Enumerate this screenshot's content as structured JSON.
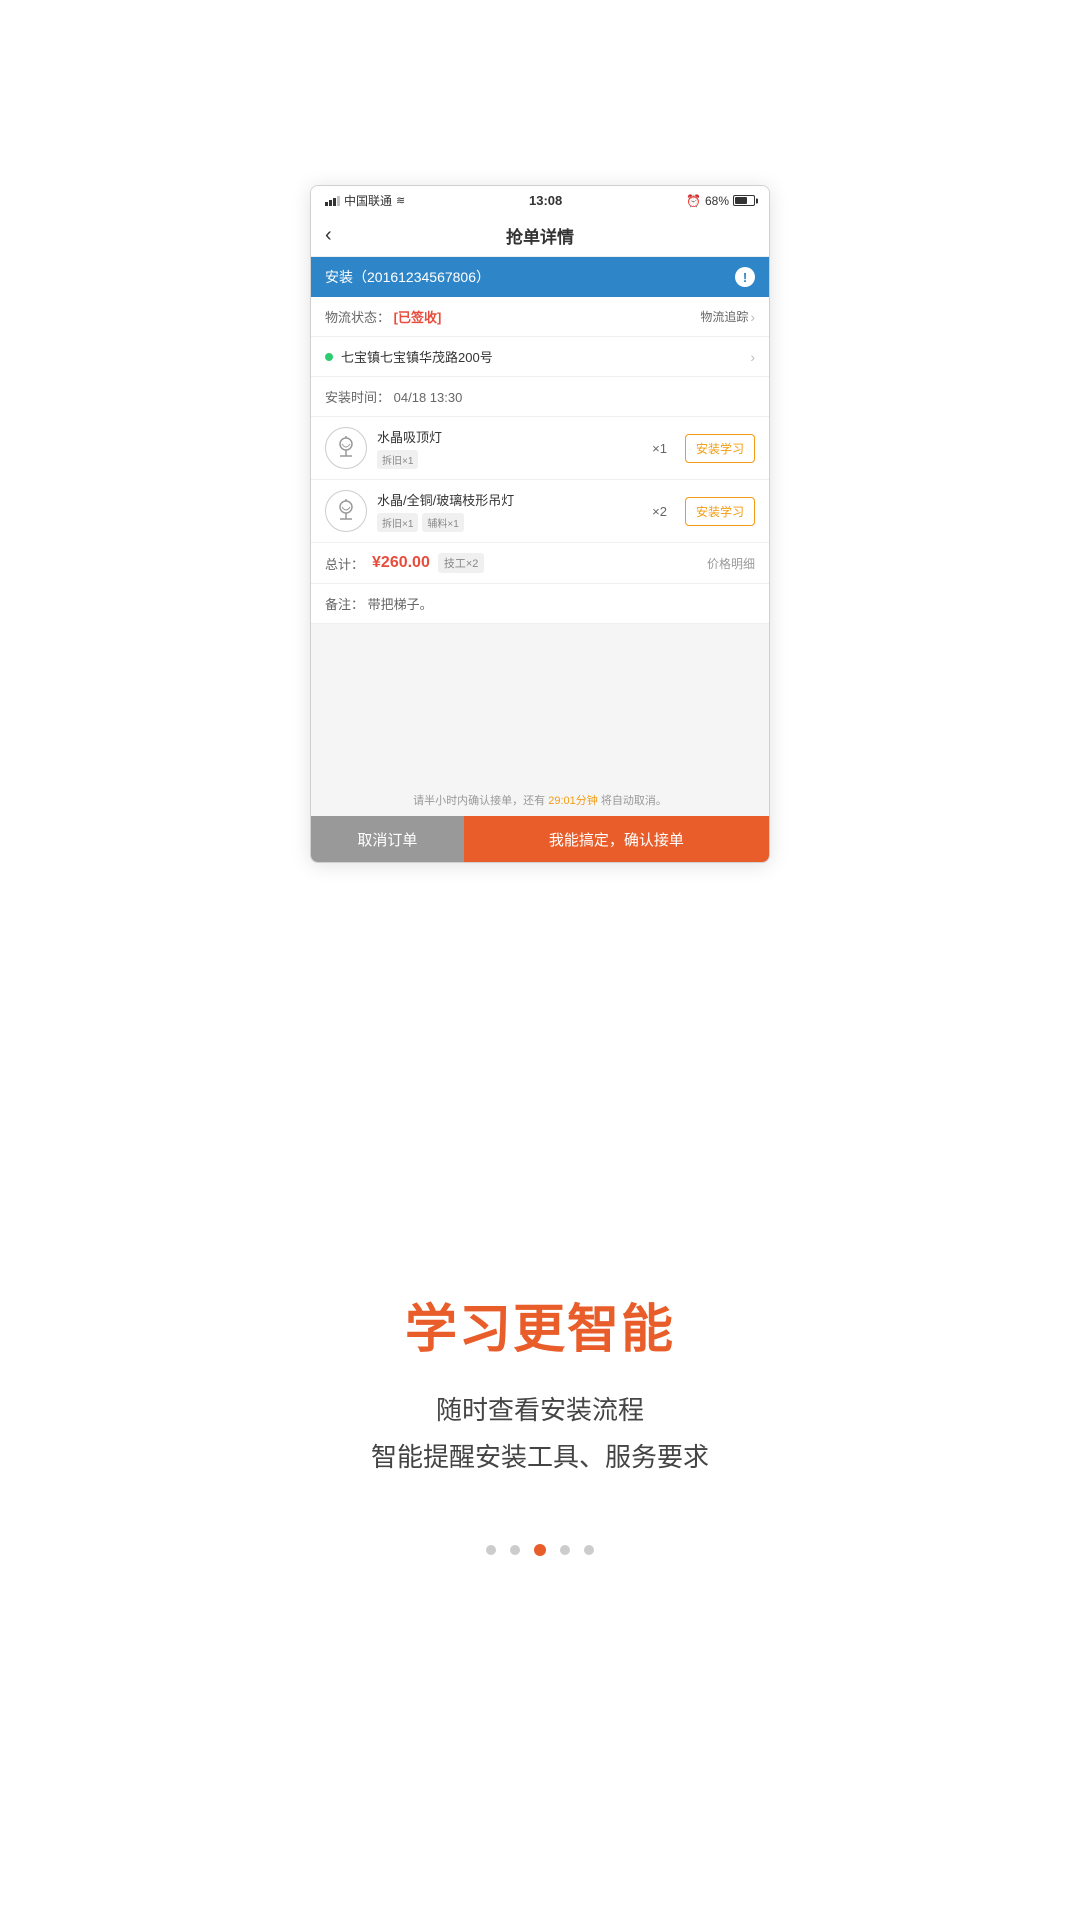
{
  "statusBar": {
    "carrier": "中国联通",
    "time": "13:08",
    "alarm": "⏰",
    "battery": "68%"
  },
  "navBar": {
    "back": "‹",
    "title": "抢单详情"
  },
  "orderHeader": {
    "title": "安装（20161234567806）",
    "warningIcon": "!"
  },
  "logistics": {
    "label": "物流状态：",
    "status": "[已签收]",
    "trackLabel": "物流追踪",
    "chevron": "›"
  },
  "address": {
    "text": "七宝镇七宝镇华茂路200号"
  },
  "installTime": {
    "label": "安装时间：",
    "value": "04/18 13:30"
  },
  "products": [
    {
      "name": "水晶吸顶灯",
      "qty": "×1",
      "tags": [
        "拆旧×1"
      ],
      "btnLabel": "安装学习"
    },
    {
      "name": "水晶/全铜/玻璃枝形吊灯",
      "qty": "×2",
      "tags": [
        "拆旧×1",
        "辅料×1"
      ],
      "btnLabel": "安装学习"
    }
  ],
  "total": {
    "label": "总计：",
    "price": "¥260.00",
    "workerTag": "技工×2",
    "detailLabel": "价格明细"
  },
  "notes": {
    "label": "备注：",
    "value": "带把梯子。"
  },
  "bottomNotice": {
    "prefix": "请半小时内确认接单，还有",
    "time": "29:01分钟",
    "suffix": "将自动取消。"
  },
  "buttons": {
    "cancel": "取消订单",
    "confirm": "我能搞定，确认接单"
  },
  "bottomSection": {
    "bigTitle": "学习更智能",
    "subText1": "随时查看安装流程",
    "subText2": "智能提醒安装工具、服务要求"
  },
  "pagination": {
    "total": 5,
    "active": 3
  }
}
